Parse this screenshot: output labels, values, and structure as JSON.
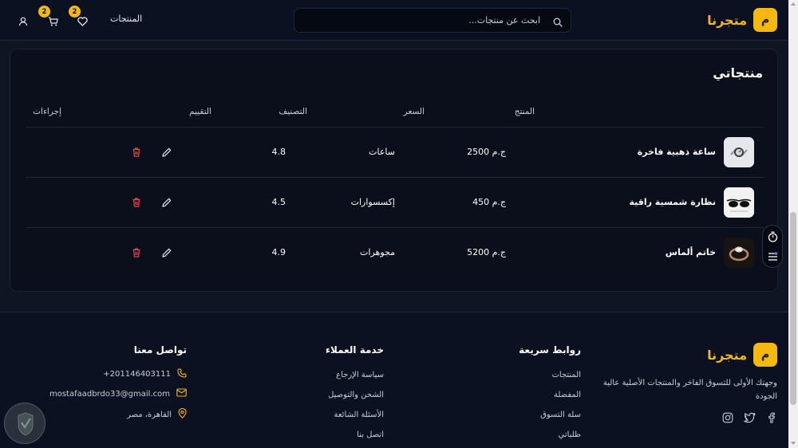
{
  "colors": {
    "accent": "#f5b80f",
    "delete": "#e5484d",
    "background": "#0f1523",
    "card": "#0a0f1b"
  },
  "header": {
    "brand_badge": "م",
    "brand_name": "متجرنا",
    "search_placeholder": "ابحث عن منتجات...",
    "nav_products": "المنتجات",
    "wishlist_count": "2",
    "cart_count": "2",
    "icons": [
      "search-icon",
      "heart-icon",
      "cart-icon",
      "user-icon"
    ]
  },
  "main": {
    "title": "منتجاتي",
    "columns": {
      "product": "المنتج",
      "price": "السعر",
      "category": "التصنيف",
      "rating": "التقييم",
      "actions": "إجراءات"
    },
    "rows": [
      {
        "name": "ساعة ذهبية فاخرة",
        "price": "2500 ج.م",
        "category": "ساعات",
        "rating": "4.8",
        "thumb": "watch"
      },
      {
        "name": "نظارة شمسية راقية",
        "price": "450 ج.م",
        "category": "إكسسوارات",
        "rating": "4.5",
        "thumb": "sunglasses"
      },
      {
        "name": "خاتم ألماس",
        "price": "5200 ج.م",
        "category": "مجوهرات",
        "rating": "4.9",
        "thumb": "ring"
      }
    ]
  },
  "floating": {
    "icons": [
      "timer-icon",
      "settings-list-icon"
    ]
  },
  "footer": {
    "brand_badge": "م",
    "brand_name": "متجرنا",
    "description": "وجهتك الأولى للتسوق الفاخر والمنتجات الأصلية عالية الجودة",
    "socials": [
      "facebook-icon",
      "twitter-icon",
      "instagram-icon"
    ],
    "quick_links": {
      "title": "روابط سريعة",
      "items": [
        "المنتجات",
        "المفضلة",
        "سلة التسوق",
        "طلباتي"
      ]
    },
    "customer_service": {
      "title": "خدمة العملاء",
      "items": [
        "سياسة الإرجاع",
        "الشحن والتوصيل",
        "الأسئلة الشائعة",
        "اتصل بنا"
      ]
    },
    "contact": {
      "title": "تواصل معنا",
      "phone": "+201146403111",
      "email": "mostafaadbrdo33@gmail.com",
      "address": "القاهرة، مصر"
    }
  }
}
